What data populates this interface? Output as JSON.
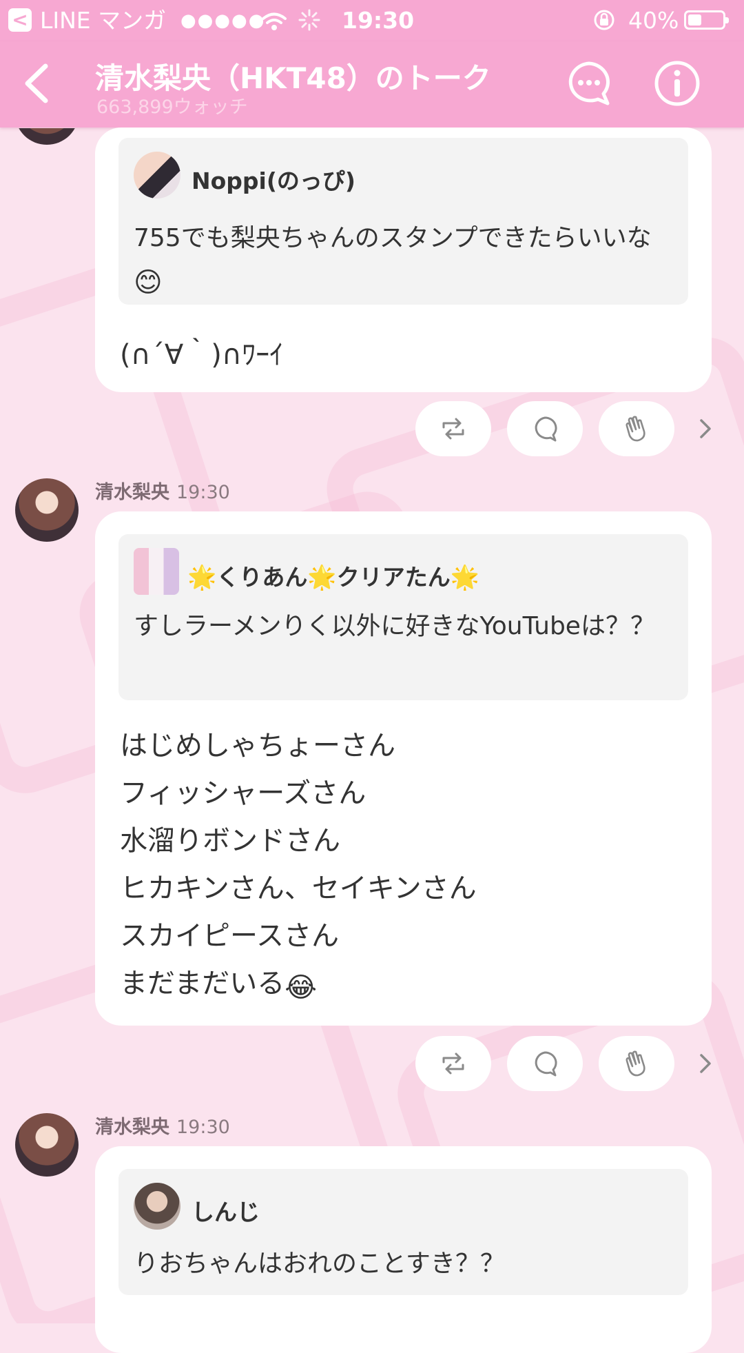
{
  "status_bar": {
    "back_app": "LINE マンガ",
    "signal": "●●●●●",
    "time": "19:30",
    "battery": "40%",
    "battery_level": 0.4
  },
  "header": {
    "title": "清水梨央（HKT48）のトーク",
    "watch_count": "663,899ウォッチ"
  },
  "messages": [
    {
      "quote_author": "Noppi(のっぴ)",
      "quote_text": "755でも梨央ちゃんのスタンプできたらいいな",
      "quote_emoji": "😊",
      "reply_text": "(∩´∀｀)∩ﾜｰｲ"
    },
    {
      "author": "清水梨央",
      "time": "19:30",
      "quote_author_star": "🌟",
      "quote_author_parts": [
        "くりあん",
        "クリアたん"
      ],
      "quote_text": "すしラーメンりく以外に好きなYouTubeは？？",
      "reply_text": "はじめしゃちょーさん\nフィッシャーズさん\n水溜りボンドさん\nヒカキンさん、セイキンさん\nスカイピースさん\nまだまだいる",
      "reply_emoji": "😂"
    },
    {
      "author": "清水梨央",
      "time": "19:30",
      "quote_author": "しんじ",
      "quote_text": "りおちゃんはおれのことすき？？"
    }
  ],
  "icons": {
    "repost": "repost-icon",
    "comment": "comment-icon",
    "clap": "clap-icon",
    "more": "chevron-right-icon"
  },
  "colors": {
    "header": "#f7a8d2",
    "background": "#fbe3ee",
    "card": "#ffffff",
    "quote": "#f3f3f3"
  }
}
